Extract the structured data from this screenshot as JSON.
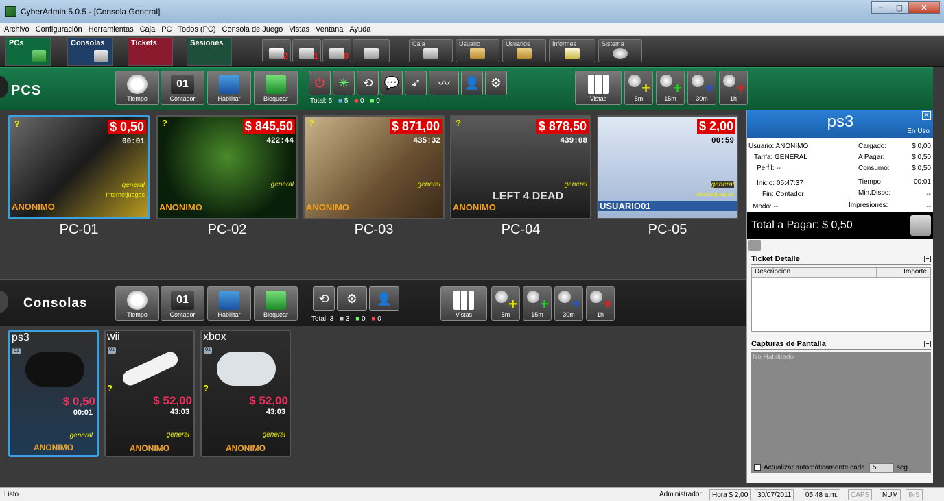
{
  "window": {
    "title": "CyberAdmin 5.0.5 - [Consola General]",
    "min": "–",
    "max": "▢",
    "close": "✕"
  },
  "menu": [
    "Archivo",
    "Configuración",
    "Herramientas",
    "Caja",
    "PC",
    "Todos (PC)",
    "Consola de Juego",
    "Vistas",
    "Ventana",
    "Ayuda"
  ],
  "mode_tabs": [
    {
      "label": "PCs",
      "bg": "#0d6b3d"
    },
    {
      "label": "Consolas",
      "bg": "#1f3f66"
    },
    {
      "label": "Tickets",
      "bg": "#8b1a2e"
    },
    {
      "label": "Sesiones",
      "bg": "#1d4f3a"
    }
  ],
  "print_counts": [
    "2",
    "1",
    "0"
  ],
  "top_tools": [
    "Caja",
    "Usuario",
    "Usuarios",
    "Informes",
    "Sistema"
  ],
  "pcs_section": {
    "title": "PCS",
    "buttons": [
      "Tiempo",
      "Contador",
      "Habilitar",
      "Bloquear"
    ],
    "counter_text": "01",
    "totals": {
      "label": "Total: 5",
      "a": "5",
      "b": "0",
      "c": "0"
    },
    "vistas": "Vistas",
    "time_buttons": [
      {
        "label": "5m",
        "color": "#e8e000"
      },
      {
        "label": "15m",
        "color": "#22cc22"
      },
      {
        "label": "30m",
        "color": "#2050e0"
      },
      {
        "label": "1h",
        "color": "#dd2020"
      }
    ]
  },
  "pcs": [
    {
      "name": "PC-01",
      "price": "$ 0,50",
      "time": "00:01",
      "tarifa": "general",
      "user": "ANONIMO",
      "extra": "internetjuegos",
      "bg": "linear-gradient(135deg,#6a6a6a,#1a1a1a 50%,#b89a20)",
      "selected": true
    },
    {
      "name": "PC-02",
      "price": "$ 845,50",
      "time": "422:44",
      "tarifa": "general",
      "user": "ANONIMO",
      "extra": "",
      "bg": "radial-gradient(circle at 50% 40%,#4a8a2a,#0a1f0a 70%)",
      "selected": false
    },
    {
      "name": "PC-03",
      "price": "$ 871,00",
      "time": "435:32",
      "tarifa": "general",
      "user": "ANONIMO",
      "extra": "",
      "bg": "linear-gradient(135deg,#c9b48a,#6a5030 60%,#3a2a1a)",
      "selected": false
    },
    {
      "name": "PC-04",
      "price": "$ 878,50",
      "time": "439:08",
      "tarifa": "general",
      "user": "ANONIMO",
      "extra": "",
      "bg": "linear-gradient(#5a5a5a,#1a1a1a)",
      "selected": false
    },
    {
      "name": "PC-05",
      "price": "$ 2,00",
      "time": "00:59",
      "tarifa": "general",
      "user": "USUARIO01",
      "extra": "internetjuegos",
      "bg": "linear-gradient(#dfe8f5,#9fb5d4)",
      "selected": false
    }
  ],
  "pc04_logo": "LEFT 4 DEAD",
  "consoles_section": {
    "title": "Consolas",
    "buttons": [
      "Tiempo",
      "Contador",
      "Habilitar",
      "Bloquear"
    ],
    "counter_text": "01",
    "totals": {
      "label": "Total: 3",
      "a": "3",
      "b": "0",
      "c": "0"
    },
    "vistas": "Vistas",
    "time_buttons": [
      {
        "label": "5m",
        "color": "#e8e000"
      },
      {
        "label": "15m",
        "color": "#22cc22"
      },
      {
        "label": "30m",
        "color": "#2050e0"
      },
      {
        "label": "1h",
        "color": "#dd2020"
      }
    ]
  },
  "consoles": [
    {
      "name": "ps3",
      "price": "$ 0,50",
      "time": "00:01",
      "tarifa": "general",
      "user": "ANONIMO",
      "badge": "01",
      "q": "",
      "ctrl_color": "#111",
      "selected": true
    },
    {
      "name": "wii",
      "price": "$ 52,00",
      "time": "43:03",
      "tarifa": "general",
      "user": "ANONIMO",
      "badge": "01",
      "q": "?",
      "ctrl_color": "#f2f2f2",
      "selected": false
    },
    {
      "name": "xbox",
      "price": "$ 52,00",
      "time": "43:03",
      "tarifa": "general",
      "user": "ANONIMO",
      "badge": "01",
      "q": "?",
      "ctrl_color": "#dde2e6",
      "selected": false
    }
  ],
  "detail": {
    "host": "ps3",
    "estado": "En Uso",
    "close": "✕",
    "rows": [
      {
        "l": "Usuario: ANONIMO",
        "k": "Cargado:",
        "v": "$ 0,00"
      },
      {
        "l": "Tarifa: GENERAL",
        "k": "A Pagar:",
        "v": "$ 0,50"
      },
      {
        "l": "Perfil: --",
        "k": "Consumo:",
        "v": "$ 0,50"
      },
      {
        "l": "Inicio: 05:47:37",
        "k": "Tiempo:",
        "v": "00:01"
      },
      {
        "l": "Fin: Contador",
        "k": "Min.Dispo:",
        "v": "--"
      },
      {
        "l": "Modo: --",
        "k": "Impresiones:",
        "v": "--"
      }
    ],
    "total": "Total a Pagar: $ 0,50",
    "ticket_title": "Ticket Detalle",
    "col_desc": "Descripcion",
    "col_imp": "Importe",
    "captures_title": "Capturas de Pantalla",
    "captures_status": "No Habilitado",
    "auto_label": "Actualizar automáticamente cada",
    "auto_value": "5",
    "auto_unit": "seg."
  },
  "status": {
    "left": "Listo",
    "user": "Administrador",
    "hour": "Hora $ 2,00",
    "date": "30/07/2011",
    "time": "05:48 a.m.",
    "caps": "CAPS",
    "num": "NUM",
    "ins": "INS"
  }
}
